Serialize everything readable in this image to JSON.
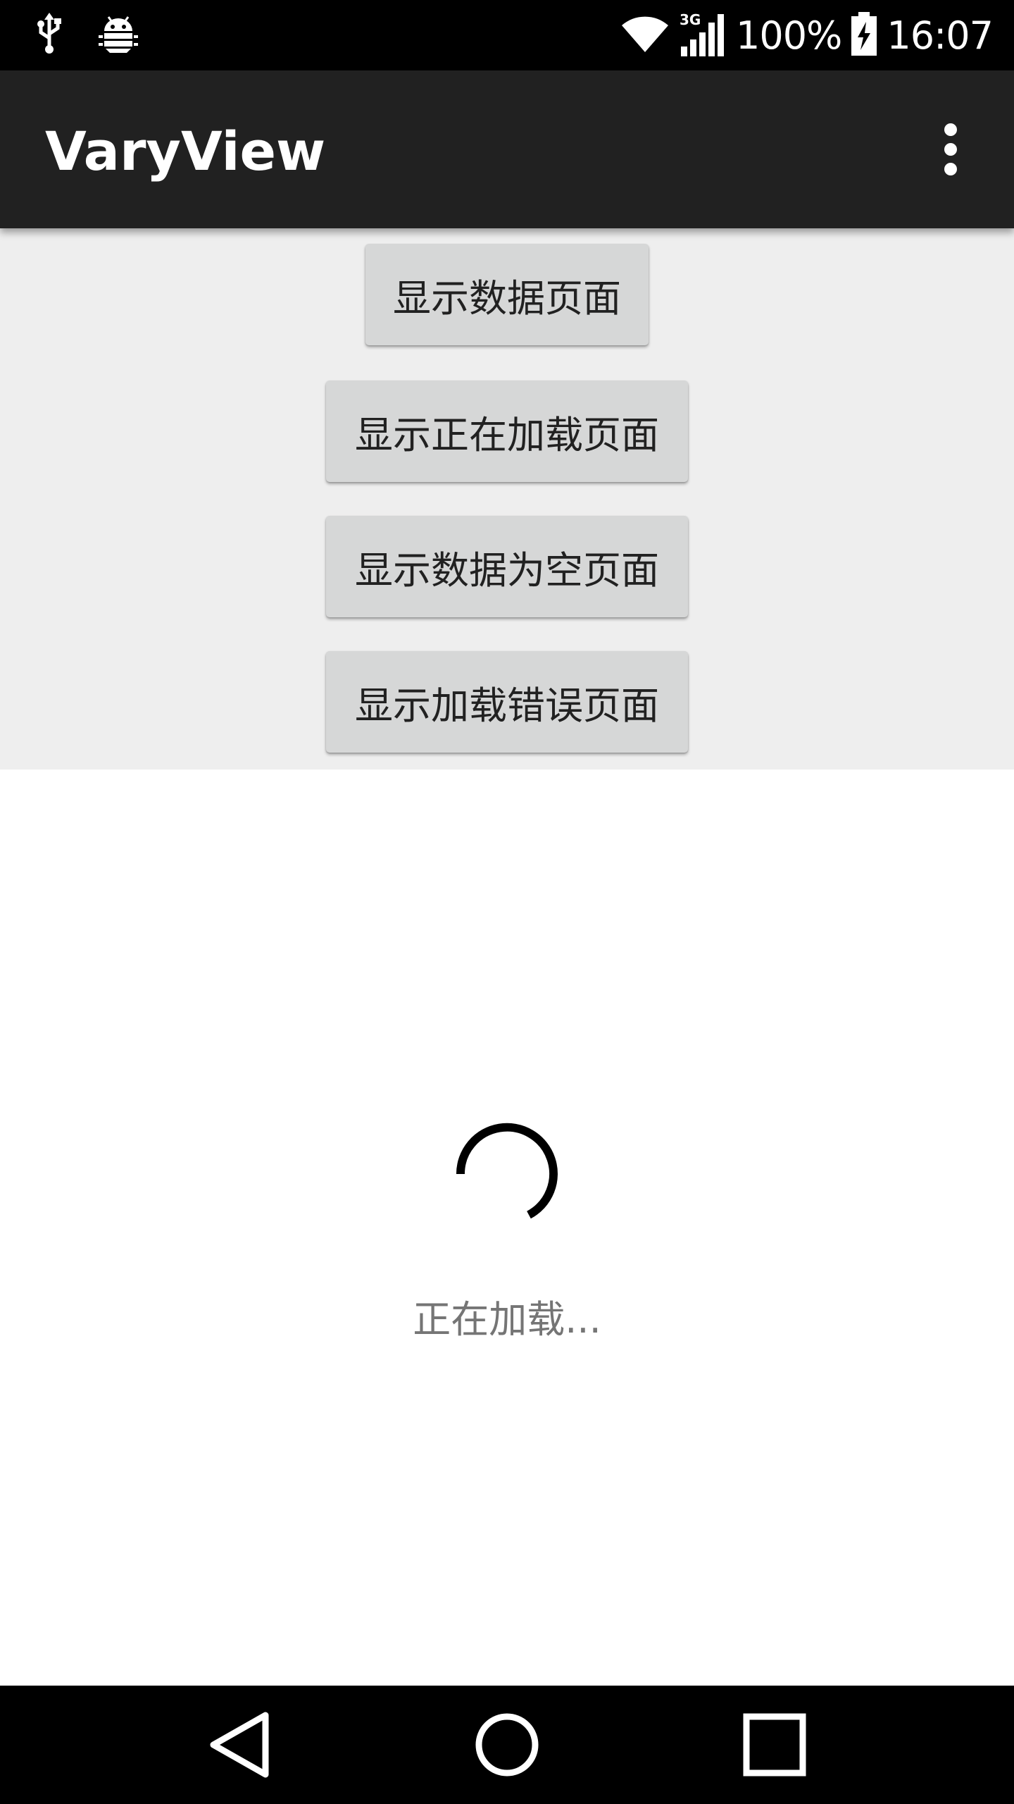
{
  "status_bar": {
    "icons_left": [
      "usb-icon",
      "android-debug-icon"
    ],
    "icons_right": [
      "wifi-icon",
      "cellular-3g-icon",
      "battery-charging-icon"
    ],
    "network_label": "3G",
    "battery_percent": "100%",
    "time": "16:07"
  },
  "app_bar": {
    "title": "VaryView",
    "overflow_icon": "more-vert-icon"
  },
  "buttons": {
    "show_data": "显示数据页面",
    "show_loading": "显示正在加载页面",
    "show_empty": "显示数据为空页面",
    "show_error": "显示加载错误页面"
  },
  "loading": {
    "text": "正在加载..."
  },
  "nav_bar": {
    "back": "back-icon",
    "home": "home-icon",
    "recents": "recents-icon"
  },
  "colors": {
    "status_bar": "#000000",
    "app_bar": "#212121",
    "panel": "#eeeeee",
    "button": "#d6d7d7",
    "loading_text": "#757575"
  }
}
